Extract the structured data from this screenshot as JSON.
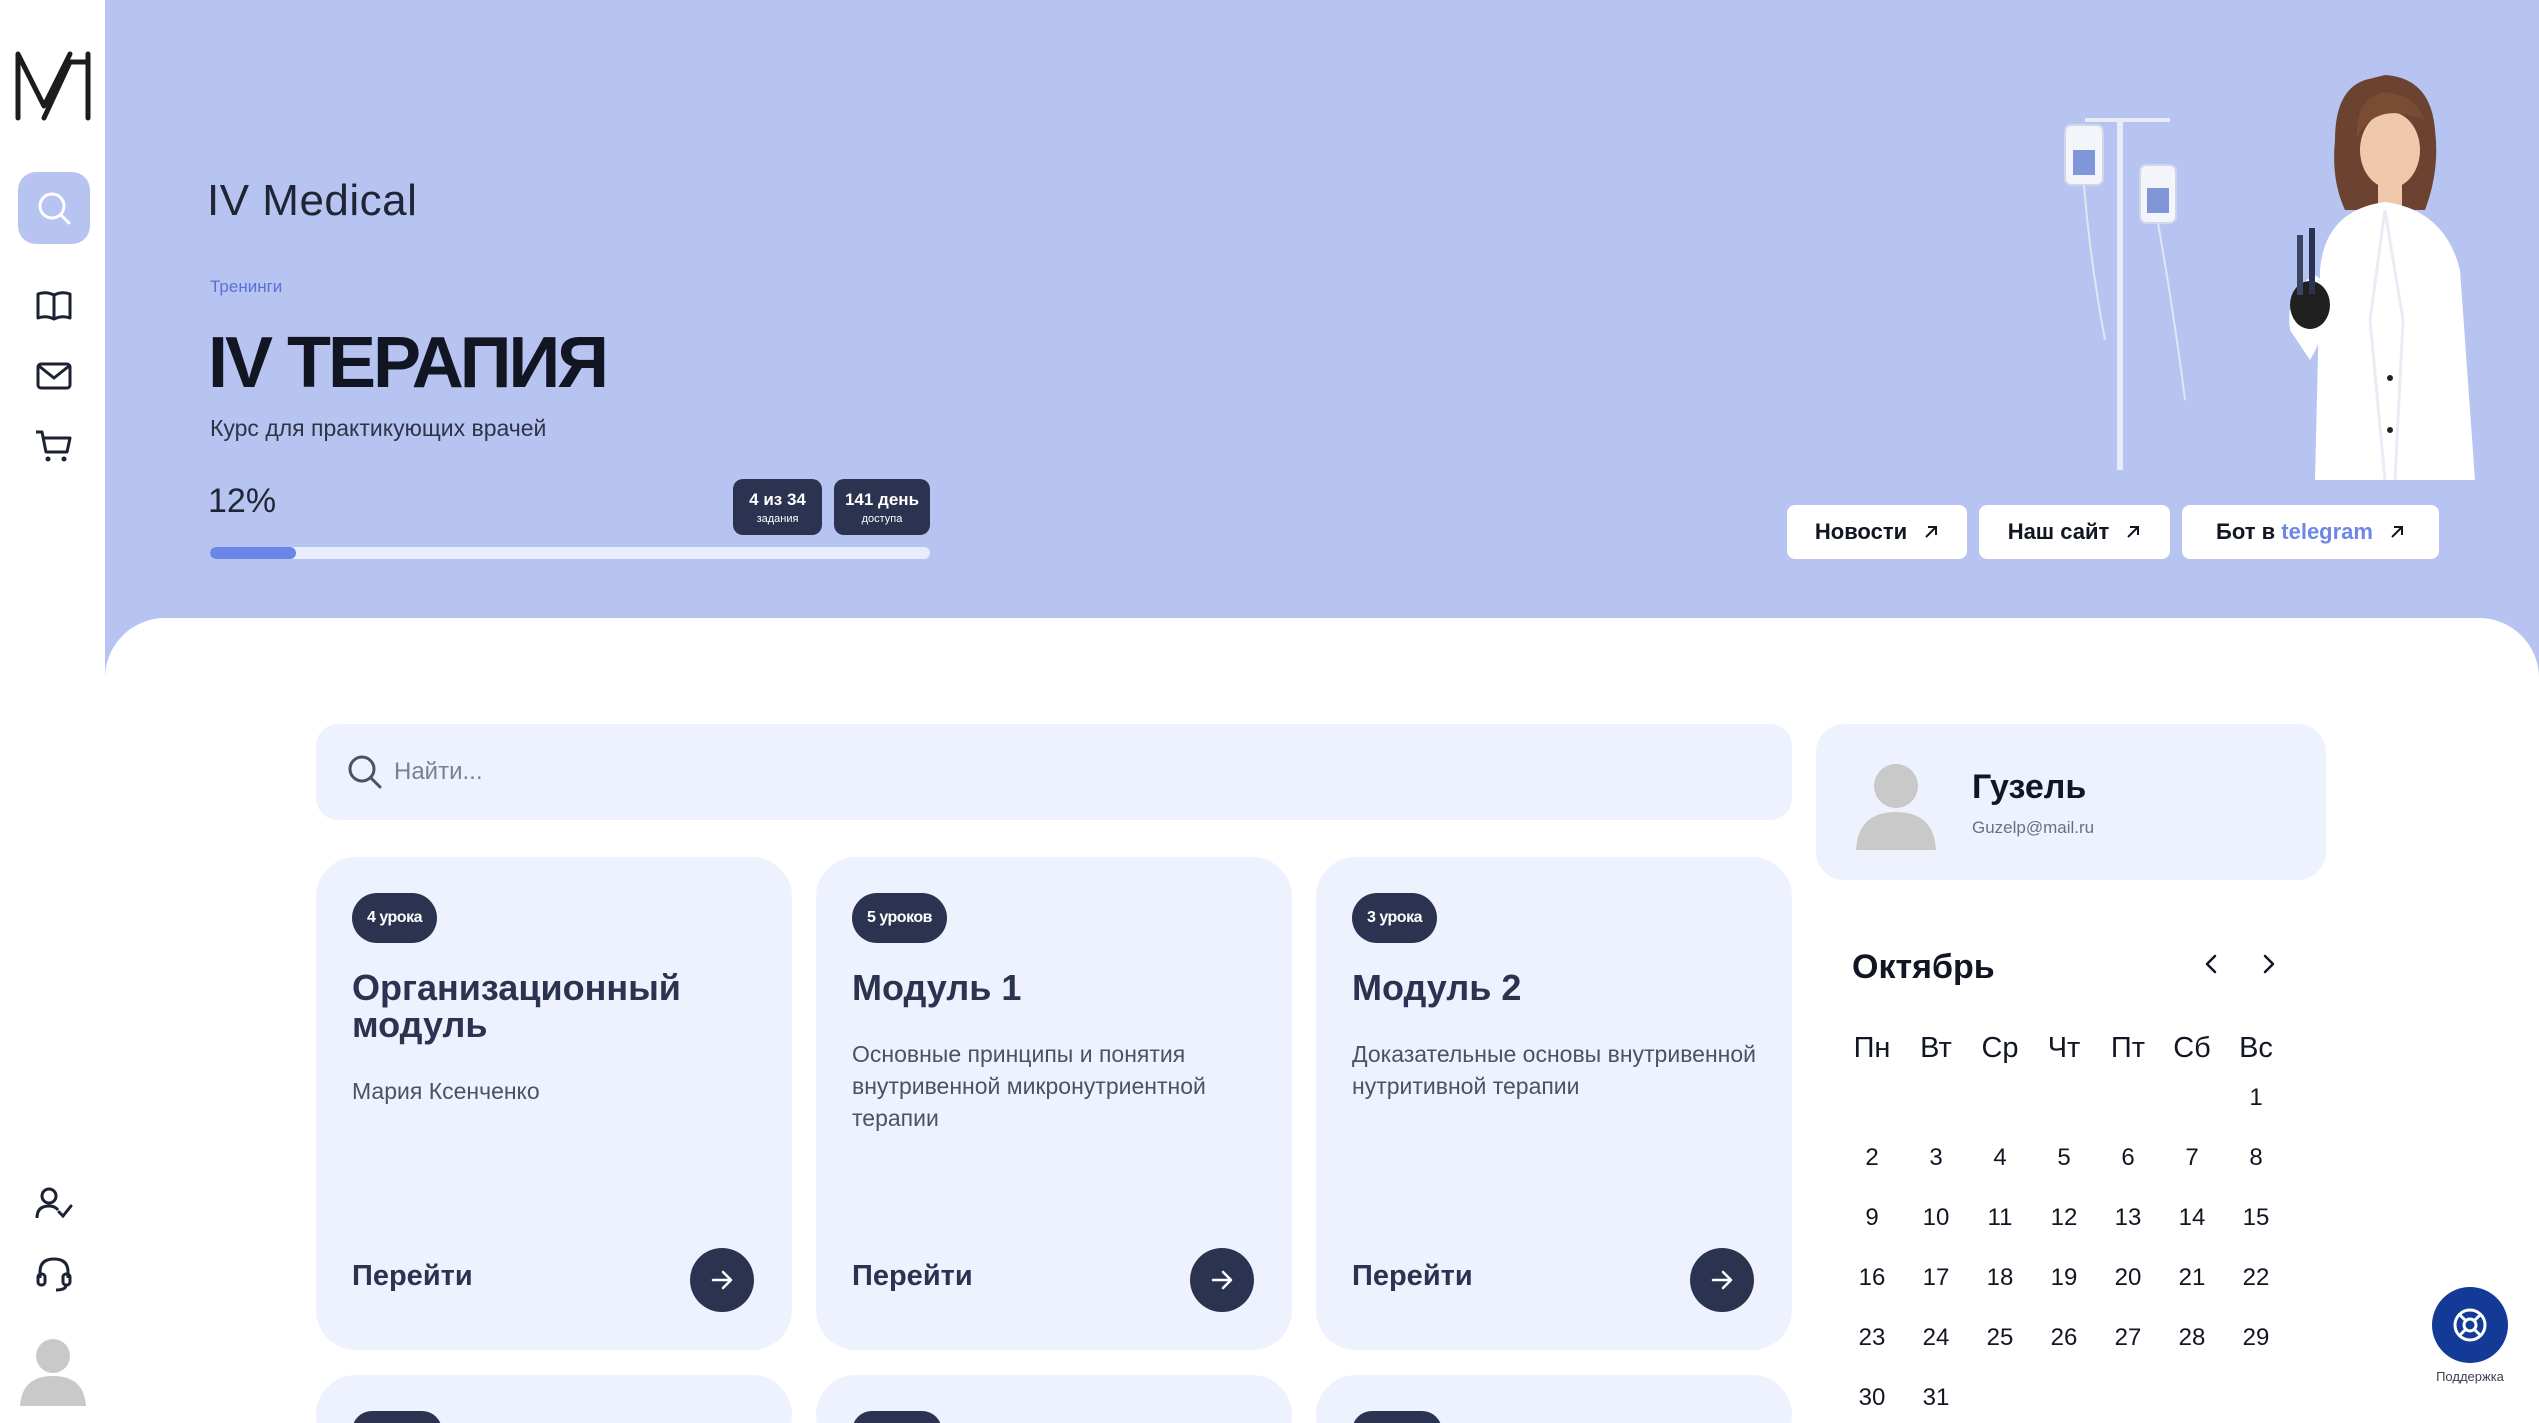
{
  "brand": "IV Medical",
  "breadcrumb": "Тренинги",
  "course": {
    "title": "IV ТЕРАПИЯ",
    "subtitle": "Курс для практикующих врачей",
    "progress_label": "12%",
    "progress_value": 12,
    "tasks_big": "4 из 34",
    "tasks_small": "задания",
    "days_big": "141 день",
    "days_small": "доступа"
  },
  "links": {
    "news": "Новости",
    "site": "Наш сайт",
    "bot_prefix": "Бот в",
    "bot_accent": "telegram"
  },
  "search": {
    "placeholder": "Найти..."
  },
  "modules": [
    {
      "badge": "4 урока",
      "title": "Организационный модуль",
      "desc": "Мария Ксенченко",
      "action": "Перейти"
    },
    {
      "badge": "5 уроков",
      "title": "Модуль 1",
      "desc": "Основные принципы и понятия внутривенной микронутриентной терапии",
      "action": "Перейти"
    },
    {
      "badge": "3 урока",
      "title": "Модуль 2",
      "desc": "Доказательные основы внутривенной нутритивной терапии",
      "action": "Перейти"
    }
  ],
  "profile": {
    "name": "Гузель",
    "email": "Guzelp@mail.ru"
  },
  "calendar": {
    "month": "Октябрь",
    "weekdays": [
      "Пн",
      "Вт",
      "Ср",
      "Чт",
      "Пт",
      "Сб",
      "Вс"
    ],
    "first_weekday_index": 6,
    "days": [
      "1",
      "2",
      "3",
      "4",
      "5",
      "6",
      "7",
      "8",
      "9",
      "10",
      "11",
      "12",
      "13",
      "14",
      "15",
      "16",
      "17",
      "18",
      "19",
      "20",
      "21",
      "22",
      "23",
      "24",
      "25",
      "26",
      "27",
      "28",
      "29",
      "30",
      "31"
    ]
  },
  "support": {
    "label": "Поддержка"
  },
  "colors": {
    "hero_bg": "#b7c4f1",
    "card_bg": "#eef2fe",
    "dark": "#2b3350",
    "accent": "#6f86e6",
    "support": "#123a96"
  }
}
